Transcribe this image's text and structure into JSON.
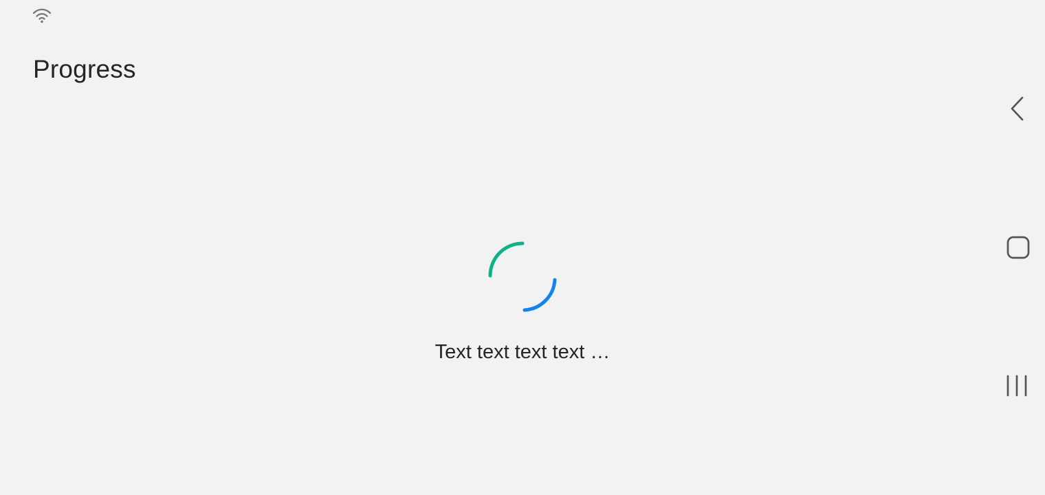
{
  "status_bar": {
    "wifi_icon": "wifi-icon"
  },
  "header": {
    "title": "Progress"
  },
  "progress": {
    "text": "Text text text text …",
    "colors": {
      "arc_start": "#0db388",
      "arc_end": "#1383f3"
    }
  },
  "navigation": {
    "back_icon": "chevron-left-icon",
    "home_icon": "rounded-square-icon",
    "recents_icon": "three-bars-icon"
  }
}
